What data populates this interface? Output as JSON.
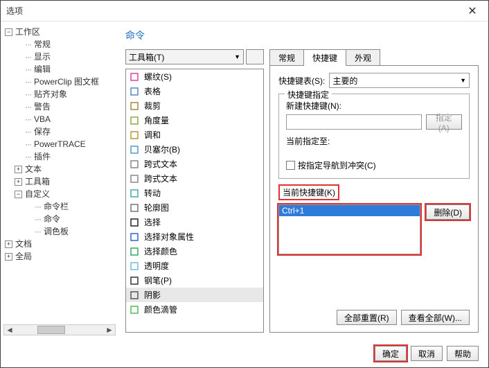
{
  "window": {
    "title": "选项",
    "close": "✕"
  },
  "tree": {
    "root": "工作区",
    "items": [
      "常规",
      "显示",
      "编辑",
      "PowerClip 图文框",
      "贴齐对象",
      "警告",
      "VBA",
      "保存",
      "PowerTRACE",
      "插件",
      "文本",
      "工具箱"
    ],
    "customize": {
      "label": "自定义",
      "children": [
        "命令栏",
        "命令",
        "调色板"
      ]
    },
    "doc": "文档",
    "global": "全局"
  },
  "page": {
    "heading": "命令",
    "category": "工具箱(T)",
    "commands": [
      {
        "label": "螺纹(S)"
      },
      {
        "label": "表格"
      },
      {
        "label": "裁剪"
      },
      {
        "label": "角度量"
      },
      {
        "label": "调和"
      },
      {
        "label": "贝塞尔(B)"
      },
      {
        "label": "跨式文本"
      },
      {
        "label": "跨式文本"
      },
      {
        "label": "转动"
      },
      {
        "label": "轮廓图"
      },
      {
        "label": "选择"
      },
      {
        "label": "选择对象属性"
      },
      {
        "label": "选择颜色"
      },
      {
        "label": "透明度"
      },
      {
        "label": "钢笔(P)"
      },
      {
        "label": "阴影",
        "selected": true
      },
      {
        "label": "颜色滴管"
      }
    ]
  },
  "tabs": {
    "general": "常规",
    "shortcut": "快捷键",
    "appearance": "外观"
  },
  "shortcut": {
    "table_label": "快捷键表(S):",
    "table_value": "主要的",
    "group_legend": "快捷键指定",
    "new_label": "新建快捷键(N):",
    "assign_btn": "指定(A)",
    "assigned_to_label": "当前指定至:",
    "nav_conflict": "按指定导航到冲突(C)",
    "current_label": "当前快捷键(K)",
    "current_value": "Ctrl+1",
    "delete_btn": "删除(D)",
    "reset_all": "全部重置(R)",
    "view_all": "查看全部(W)..."
  },
  "footer": {
    "ok": "确定",
    "cancel": "取消",
    "help": "帮助"
  }
}
